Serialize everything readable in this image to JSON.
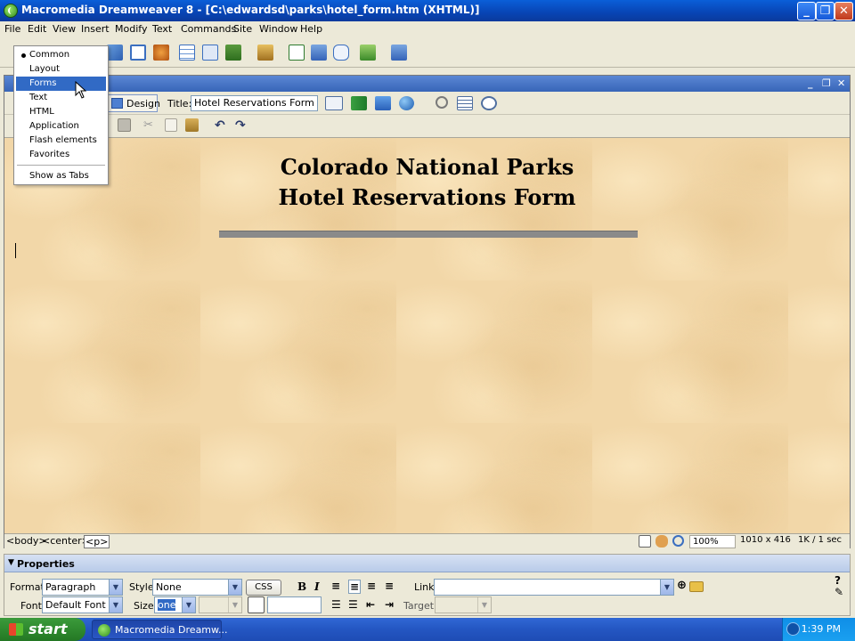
{
  "window": {
    "title": "Macromedia Dreamweaver 8 - [C:\\edwardsd\\parks\\hotel_form.htm (XHTML)]",
    "controls": {
      "minimize": "_",
      "maximize": "❐",
      "close": "✕"
    }
  },
  "menubar": [
    "File",
    "Edit",
    "View",
    "Insert",
    "Modify",
    "Text",
    "Commands",
    "Site",
    "Window",
    "Help"
  ],
  "insert_category_menu": {
    "items": [
      "Common",
      "Layout",
      "Forms",
      "Text",
      "HTML",
      "Application",
      "Flash elements",
      "Favorites"
    ],
    "checked": "Common",
    "highlighted": "Forms",
    "footer": "Show as Tabs"
  },
  "document_window": {
    "controls": {
      "minimize": "_",
      "restore": "❐",
      "close": "✕"
    }
  },
  "document_toolbar": {
    "design_label": "Design",
    "title_label": "Title:",
    "title_value": "Hotel Reservations Form"
  },
  "page": {
    "heading_line1": "Colorado National Parks",
    "heading_line2": "Hotel Reservations Form"
  },
  "status_bar": {
    "tags": [
      "<body>",
      "<center>",
      "<p>"
    ],
    "zoom": "100%",
    "window_size": "1010 x 416",
    "download": "1K / 1 sec"
  },
  "properties": {
    "title": "Properties",
    "format_label": "Format",
    "format_value": "Paragraph",
    "style_label": "Style",
    "style_value": "None",
    "css_button": "CSS",
    "link_label": "Link",
    "link_value": "",
    "font_label": "Font",
    "font_value": "Default Font",
    "size_label": "Size",
    "size_value": "one",
    "target_label": "Target",
    "bold": "B",
    "italic": "I"
  },
  "taskbar": {
    "start": "start",
    "task_item": "Macromedia Dreamw...",
    "clock": "1:39 PM"
  }
}
